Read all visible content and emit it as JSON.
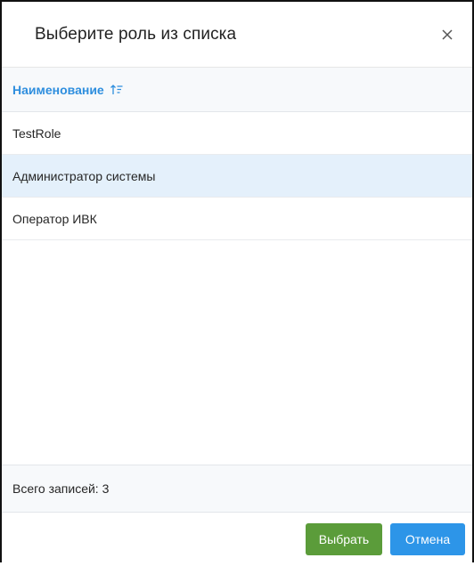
{
  "dialog": {
    "title": "Выберите роль из списка",
    "close_label": "×"
  },
  "table": {
    "column_header": "Наименование",
    "sort_icon": "sort-ascending-icon",
    "rows": [
      {
        "name": "TestRole",
        "selected": false
      },
      {
        "name": "Администратор системы",
        "selected": true
      },
      {
        "name": "Оператор ИВК",
        "selected": false
      }
    ]
  },
  "footer": {
    "total_records": "Всего записей: 3"
  },
  "buttons": {
    "select_label": "Выбрать",
    "cancel_label": "Отмена"
  },
  "colors": {
    "accent_blue": "#2e8ede",
    "select_green": "#5b9c3a",
    "cancel_blue": "#2d95e8",
    "selected_row": "#e4f0fb"
  }
}
